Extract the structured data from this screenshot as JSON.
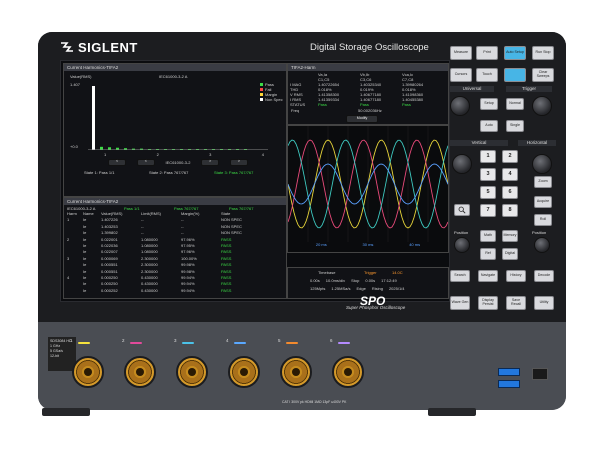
{
  "brand": {
    "name": "SIGLENT",
    "model_title": "Digital Storage Oscilloscope",
    "series_mark": "SPO",
    "series_sub": "Super Phosphor Oscilloscope"
  },
  "screen": {
    "harmonics_panel": {
      "title": "Current Harmonics-TIFA2",
      "y_label": "Value(RMS)",
      "y_top": "1.407",
      "y_bottom": "+0.0",
      "standard": "IEC61000-3-2 A",
      "legend": [
        "Pass",
        "Fail",
        "Margin",
        "Non Spec"
      ],
      "legend_colors": [
        "#3cdc46",
        "#ff4545",
        "#ffd633",
        "#ffffff"
      ],
      "bar_values": [
        1.407,
        0.07,
        0.06,
        0.05,
        0.04,
        0.03,
        0.03,
        0.02,
        0.02,
        0.02,
        0.02,
        0.02,
        0.02,
        0.02,
        0.02,
        0.02,
        0.02,
        0.02,
        0.02,
        0.02
      ],
      "x_ticks": [
        "1",
        "2",
        "3",
        "4"
      ],
      "nav_label": "IEC61000-3-2",
      "states": [
        "State 1: Pass 1/1",
        "State 2: Pass 767/767",
        "State 3: Pass 767/767"
      ]
    },
    "harmonics_table": {
      "title": "Current Harmonics-TIFA2",
      "summary": {
        "standard": "IEC61000-3-2 A",
        "pass1": "Pass 1/1",
        "pass2": "Pass 767/767",
        "pass3": "Pass 767/767"
      },
      "columns": [
        "Harm",
        "Name",
        "Value(RMS)",
        "Limit(RMS)",
        "Margin(%)",
        "State"
      ],
      "rows": [
        [
          "1",
          "Ie",
          "1.407226",
          "--",
          "--",
          "NON SPEC"
        ],
        [
          "",
          "Ie",
          "1.403253",
          "--",
          "--",
          "NON SPEC"
        ],
        [
          "",
          "Ie",
          "1.399802",
          "--",
          "--",
          "NON SPEC"
        ],
        [
          "2",
          "Ie",
          "0.022001",
          "1.080000",
          "97.96%",
          "PASS"
        ],
        [
          "",
          "Ie",
          "0.022036",
          "1.080000",
          "97.95%",
          "PASS"
        ],
        [
          "",
          "Ie",
          "0.022007",
          "1.080000",
          "97.96%",
          "PASS"
        ],
        [
          "3",
          "Ie",
          "0.000069",
          "2.300000",
          "100.00%",
          "PASS"
        ],
        [
          "",
          "Ie",
          "0.000551",
          "2.300000",
          "99.98%",
          "PASS"
        ],
        [
          "",
          "Ie",
          "0.000551",
          "2.300000",
          "99.98%",
          "PASS"
        ],
        [
          "4",
          "Ie",
          "0.000250",
          "0.430000",
          "99.94%",
          "PASS"
        ],
        [
          "",
          "Ie",
          "0.000250",
          "0.430000",
          "99.94%",
          "PASS"
        ],
        [
          "",
          "Ie",
          "0.000252",
          "0.430000",
          "99.94%",
          "PASS"
        ]
      ]
    },
    "meas_panel": {
      "title": "TIFA2-Harm",
      "cols": [
        "Va,Ia",
        "Vb,Ib",
        "Vca,Ic"
      ],
      "cols2": [
        "C1,C5",
        "C3,C6",
        "C7,C8"
      ],
      "rows": [
        [
          "I MAG",
          "1.40722654",
          "1.40325340",
          "1.39980264"
        ],
        [
          "THD",
          "0.018%",
          "0.019%",
          "0.018%"
        ],
        [
          "V RMS",
          "1.41358300",
          "1.40677180",
          "1.41098360"
        ],
        [
          "I RMS",
          "1.41359334",
          "1.40677180",
          "1.40455380"
        ],
        [
          "STATUS",
          "Pass",
          "Pass",
          "Pass"
        ]
      ],
      "freq_label": "Freq",
      "freq_value": "50.002036Hz",
      "modify": "Modify"
    },
    "waveform": {
      "x_labels": [
        "20 ms",
        "30 ms",
        "40 ms"
      ],
      "colors": [
        "#e6d43a",
        "#e84a7a",
        "#3ec9c0",
        "#5aa0ff"
      ]
    },
    "timebase": {
      "labels": [
        "Timebase",
        "Trigger"
      ],
      "row1": [
        "0.00s",
        "10.0ms/div",
        "Stop",
        "0.00s",
        "17:12:49"
      ],
      "row2": [
        "125Mpts",
        "1.25MSa/s",
        "Edge",
        "Rising",
        "2025/1/4"
      ],
      "trigger_value": "14.0C"
    }
  },
  "panel": {
    "top_keys": [
      [
        "Measure",
        "Print",
        "Auto Setup",
        "Run Stop"
      ],
      [
        "Cursors",
        "Touch",
        "",
        "Clear Sweeps"
      ]
    ],
    "trigger_label": "Trigger",
    "universal_label": "Universal",
    "setup_keys": [
      "Setup",
      "Normal",
      "Auto",
      "Single"
    ],
    "vertical_label": "Vertical",
    "horizontal_label": "Horizontal",
    "channel_keys": [
      "1",
      "2",
      "3",
      "4",
      "5",
      "6",
      "7",
      "8"
    ],
    "right_keys": [
      "Zoom",
      "Acquire",
      "Roll"
    ],
    "math_keys": [
      "Math",
      "Memory",
      "Ref",
      "Digital"
    ],
    "bottom_keys": [
      "Search",
      "Navigate",
      "History",
      "Decode"
    ],
    "lowest_keys": [
      "Wave Gen",
      "Display Persist",
      "Save Recall",
      "Utility"
    ],
    "position_label": "Position",
    "variable_label": "Variable",
    "intensity_label": "Intensity"
  },
  "front": {
    "model": "SDS3084 HD",
    "specs": [
      "1 GHz",
      "5 GSa/s",
      "12-bit"
    ],
    "channels": [
      "1",
      "2",
      "3",
      "4",
      "5",
      "6"
    ],
    "channel_colors": [
      "#f5e23d",
      "#e24a9b",
      "#4bc2e8",
      "#5aa8ff",
      "#f28a2e",
      "#b48bff"
    ],
    "warning": "CAT I 300V pk  HDMI  1MΩ 13pF ≤400V PK",
    "usb_label": "USB"
  }
}
